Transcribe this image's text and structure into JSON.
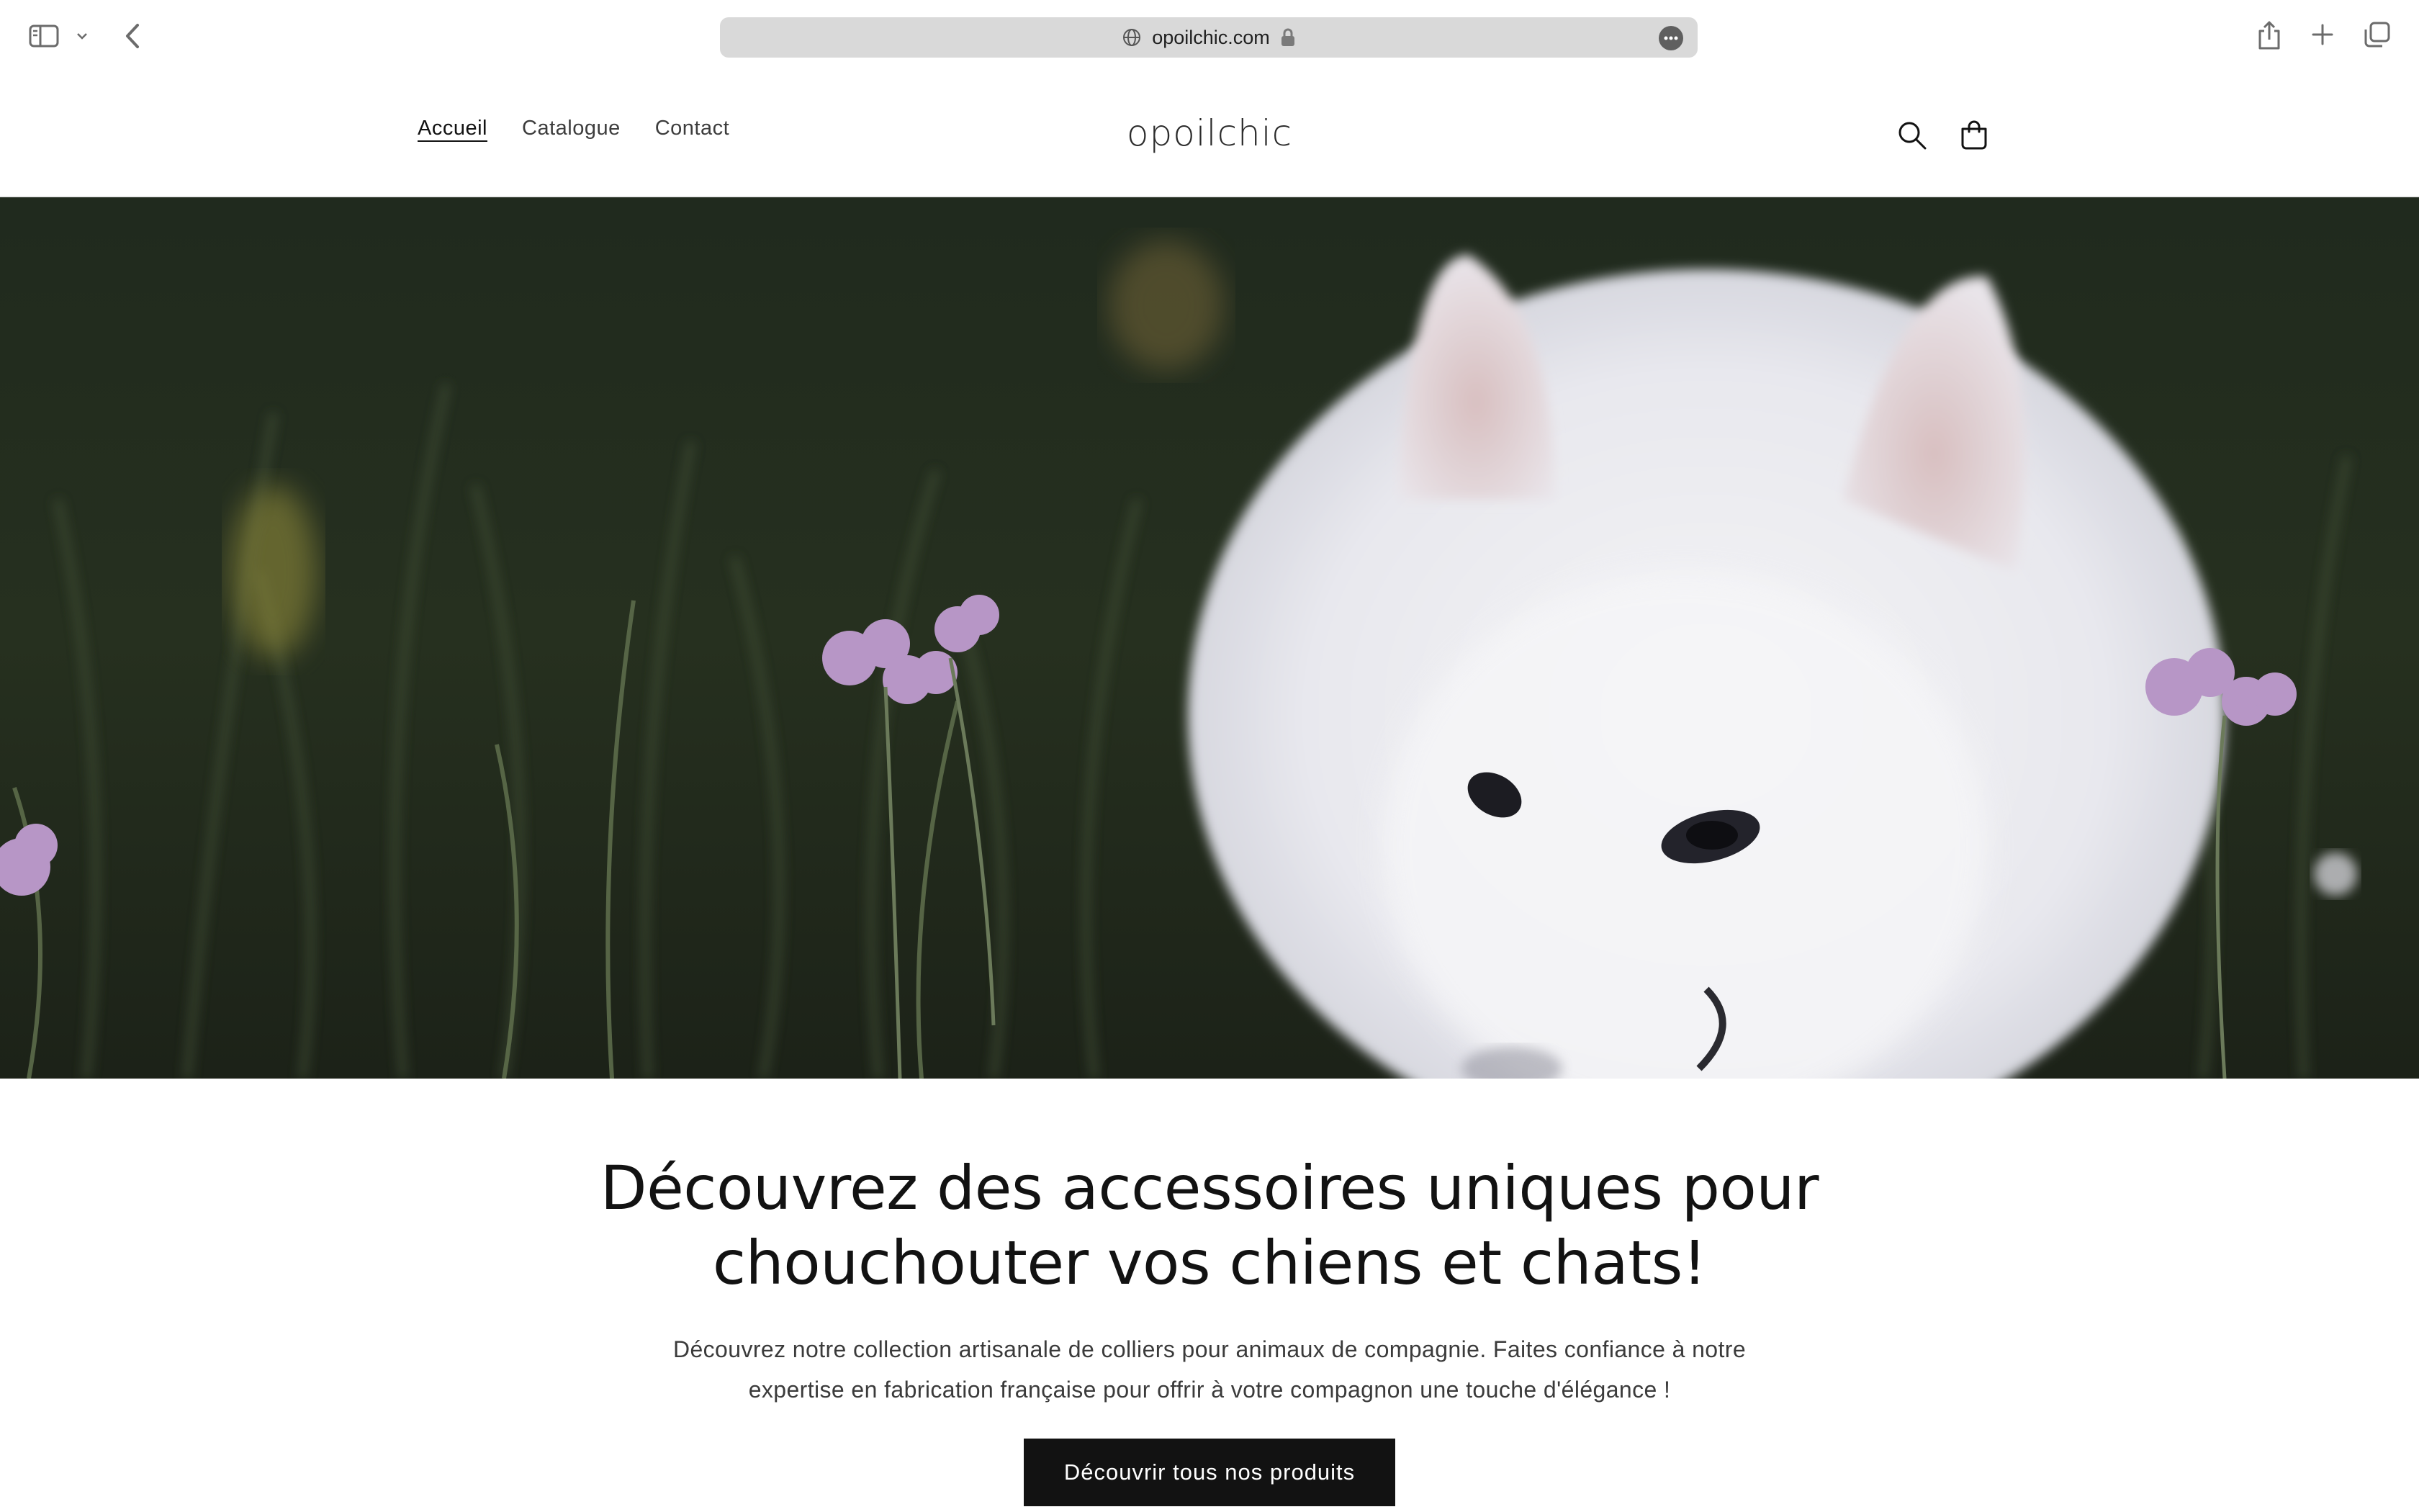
{
  "browser": {
    "url": "opoilchic.com",
    "icons": {
      "sidebar": "sidebar-icon",
      "chevron": "chevron-down-icon",
      "back": "chevron-left-icon",
      "globe": "globe-icon",
      "lock": "lock-icon",
      "more": "ellipsis-icon",
      "share": "share-icon",
      "new_tab": "plus-icon",
      "tabs": "tabs-overview-icon"
    }
  },
  "header": {
    "logo": "opoilchic",
    "nav": [
      {
        "label": "Accueil",
        "active": true
      },
      {
        "label": "Catalogue",
        "active": false
      },
      {
        "label": "Contact",
        "active": false
      }
    ],
    "icons": {
      "search": "search-icon",
      "cart": "cart-icon"
    }
  },
  "hero": {
    "image": "white dog among wildflowers",
    "title_line1": "Découvrez des accessoires uniques pour",
    "title_line2": "chouchouter vos chiens et chats!",
    "text_line1": "Découvrez notre collection artisanale de colliers pour animaux de compagnie. Faites confiance à notre",
    "text_line2": "expertise en fabrication française pour offrir à votre compagnon une touche d'élégance !",
    "cta_label": "Découvrir tous nos produits"
  },
  "colors": {
    "button_bg": "#121212",
    "address_bar": "#d9d9d9",
    "text": "#121212"
  }
}
